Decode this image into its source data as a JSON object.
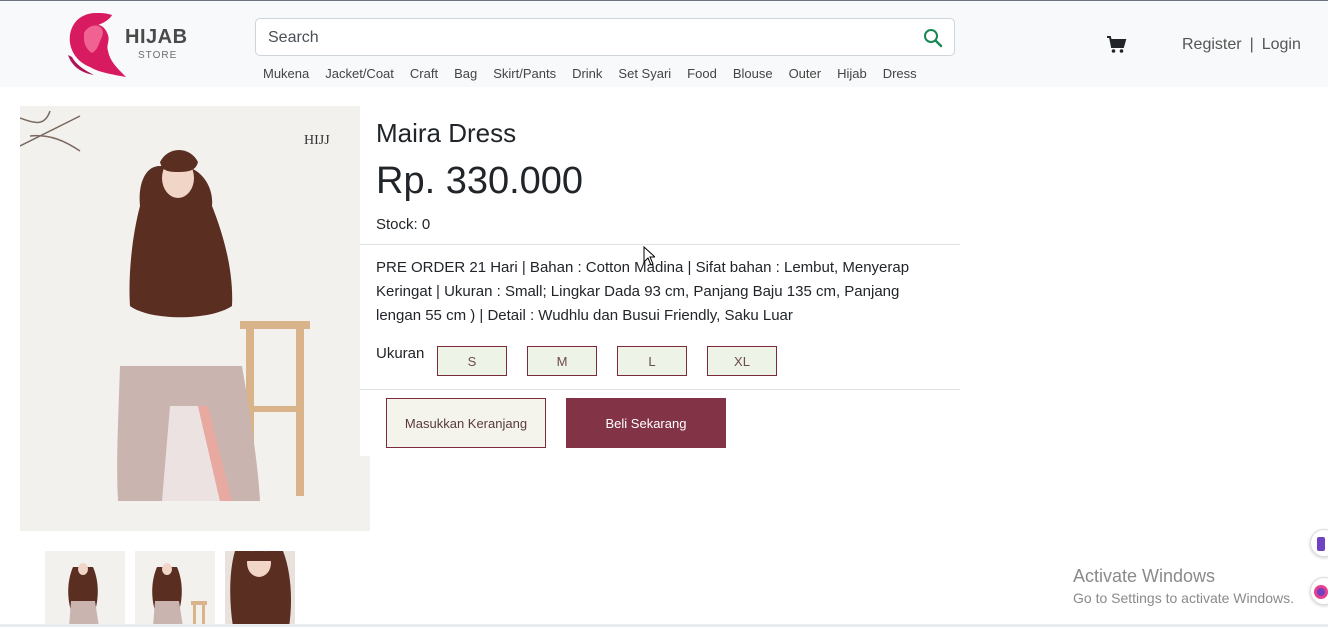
{
  "brand": {
    "name": "HIJAB",
    "sub": "STORE",
    "colors": {
      "primary": "#823446",
      "logo_pink": "#d81b60"
    }
  },
  "search": {
    "placeholder": "Search"
  },
  "categories": [
    "Mukena",
    "Jacket/Coat",
    "Craft",
    "Bag",
    "Skirt/Pants",
    "Drink",
    "Set Syari",
    "Food",
    "Blouse",
    "Outer",
    "Hijab",
    "Dress"
  ],
  "auth": {
    "register": "Register",
    "separator": "|",
    "login": "Login"
  },
  "product": {
    "image_watermark": "HIJJ",
    "title": "Maira Dress",
    "price": "Rp. 330.000",
    "stock": "Stock: 0",
    "description": "PRE ORDER 21 Hari | Bahan : Cotton Madina | Sifat bahan : Lembut, Menyerap Keringat | Ukuran : Small; Lingkar Dada 93 cm, Panjang Baju 135 cm, Panjang lengan 55 cm ) | Detail : Wudhlu dan Busui Friendly, Saku Luar",
    "size_label": "Ukuran",
    "sizes": [
      "S",
      "M",
      "L",
      "XL"
    ]
  },
  "actions": {
    "add_to_cart": "Masukkan Keranjang",
    "buy_now": "Beli Sekarang"
  },
  "windows_notice": {
    "line1": "Activate Windows",
    "line2": "Go to Settings to activate Windows."
  }
}
